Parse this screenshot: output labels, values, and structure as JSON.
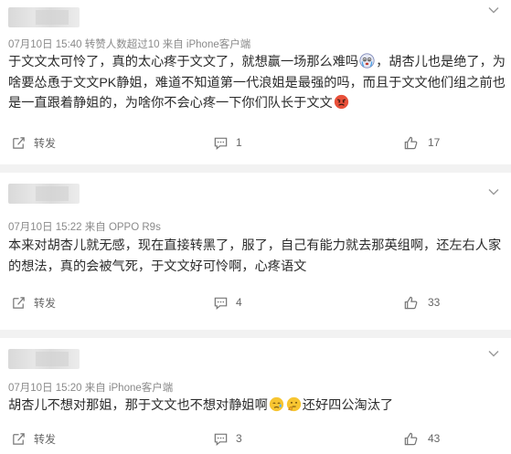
{
  "comments": [
    {
      "meta": "07月10日 15:40 转赞人数超过10  来自 iPhone客户端",
      "text_parts": [
        "于文文太可怜了，真的太心疼于文文了，就想赢一场那么难吗",
        "，胡杏儿也是绝了，为啥要怂恿于文文PK静姐，难道不知道第一代浪姐是最强的吗，而且于文文他们组之前也是一直跟着静姐的，为啥你不会心疼一下你们队长于文文"
      ],
      "emojis": [
        "crying-face-emoji",
        "angry-face-emoji"
      ],
      "share_label": "转发",
      "comment_count": "1",
      "like_count": "17"
    },
    {
      "meta": "07月10日 15:22 来自 OPPO R9s",
      "text": "本来对胡杏儿就无感，现在直接转黑了，服了，自己有能力就去那英组啊，还左右人家的想法，真的会被气死，于文文好可怜啊，心疼语文",
      "share_label": "转发",
      "comment_count": "4",
      "like_count": "33"
    },
    {
      "meta": "07月10日 15:20 来自 iPhone客户端",
      "text_parts": [
        "胡杏儿不想对那姐，那于文文也不想对静姐啊",
        "还好四公淘汰了"
      ],
      "emojis": [
        "sad-face-emoji",
        "thinking-face-emoji"
      ],
      "share_label": "转发",
      "comment_count": "3",
      "like_count": "43"
    }
  ],
  "colors": {
    "separator": "#f2f2f2",
    "meta_text": "#8a8a8a",
    "body_text": "#2b2b2b",
    "emoji_yellow": "#f7c531"
  }
}
